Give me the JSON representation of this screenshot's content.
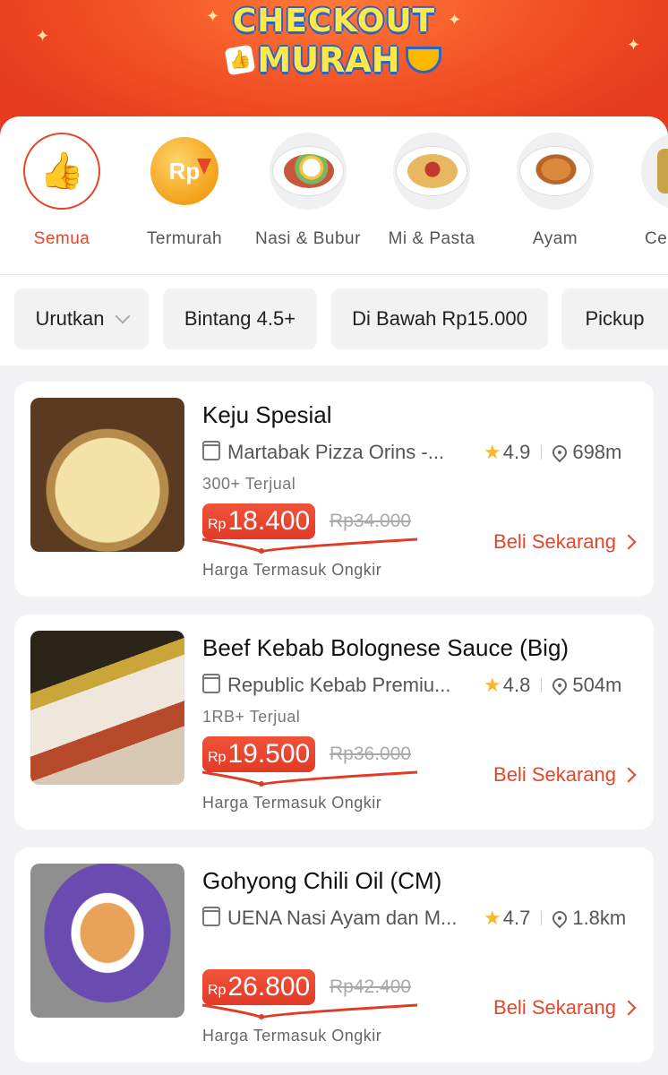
{
  "banner": {
    "line1": "CHECKOUT",
    "line2": "MURAH"
  },
  "categories": [
    {
      "label": "Semua",
      "icon": "thumbs-up-icon",
      "active": true
    },
    {
      "label": "Termurah",
      "icon": "rp-coin-icon"
    },
    {
      "label": "Nasi & Bubur",
      "icon": "rice-plate-icon"
    },
    {
      "label": "Mi & Pasta",
      "icon": "pasta-plate-icon"
    },
    {
      "label": "Ayam",
      "icon": "chicken-icon"
    },
    {
      "label": "Ce",
      "icon": "snack-icon"
    }
  ],
  "filters": [
    {
      "label": "Urutkan"
    },
    {
      "label": "Bintang 4.5+"
    },
    {
      "label": "Di Bawah Rp15.000"
    },
    {
      "label": "Pickup"
    }
  ],
  "products": [
    {
      "title": "Keju Spesial",
      "shop": "Martabak Pizza Orins -...",
      "rating": "4.9",
      "distance": "698m",
      "sold": "300+ Terjual",
      "currency": "Rp",
      "price": "18.400",
      "old_price": "Rp34.000",
      "note": "Harga Termasuk Ongkir",
      "cta": "Beli Sekarang"
    },
    {
      "title": "Beef Kebab Bolognese Sauce (Big)",
      "shop": "Republic Kebab Premiu...",
      "rating": "4.8",
      "distance": "504m",
      "sold": "1RB+ Terjual",
      "currency": "Rp",
      "price": "19.500",
      "old_price": "Rp36.000",
      "note": "Harga Termasuk Ongkir",
      "cta": "Beli Sekarang"
    },
    {
      "title": "Gohyong Chili Oil (CM)",
      "shop": "UENA Nasi Ayam dan M...",
      "rating": "4.7",
      "distance": "1.8km",
      "sold": "",
      "currency": "Rp",
      "price": "26.800",
      "old_price": "Rp42.400",
      "note": "Harga Termasuk Ongkir",
      "cta": "Beli Sekarang"
    }
  ],
  "colors": {
    "accent": "#e6452a",
    "star": "#f5b82e",
    "banner": "#f25225"
  }
}
